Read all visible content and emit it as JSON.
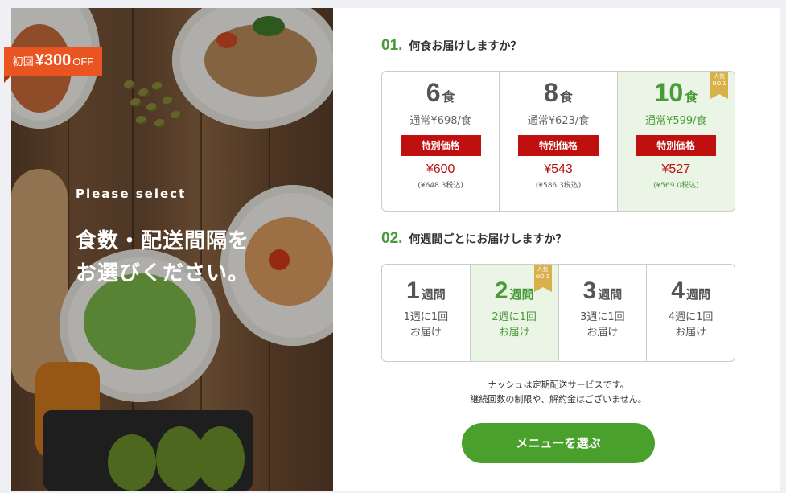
{
  "hero": {
    "subtitle": "Please select",
    "title_line1": "食数・配送間隔を",
    "title_line2": "お選びください。",
    "badge": {
      "prefix": "初回",
      "amount": "¥300",
      "suffix": "OFF"
    }
  },
  "q1": {
    "number": "01.",
    "text": "何食お届けしますか？",
    "options": [
      {
        "count": "6",
        "unit": "食",
        "regular": "通常¥698/食",
        "special": "特別価格",
        "price": "¥600",
        "tax": "(¥648.3税込)",
        "selected": false,
        "popular": false
      },
      {
        "count": "8",
        "unit": "食",
        "regular": "通常¥623/食",
        "special": "特別価格",
        "price": "¥543",
        "tax": "(¥586.3税込)",
        "selected": false,
        "popular": false
      },
      {
        "count": "10",
        "unit": "食",
        "regular": "通常¥599/食",
        "special": "特別価格",
        "price": "¥527",
        "tax": "(¥569.0税込)",
        "selected": true,
        "popular": true
      }
    ]
  },
  "popular_badge": {
    "line1": "人気",
    "line2": "NO.1"
  },
  "q2": {
    "number": "02.",
    "text": "何週間ごとにお届けしますか？",
    "options": [
      {
        "count": "1",
        "unit": "週間",
        "line1": "1週に1回",
        "line2": "お届け",
        "selected": false,
        "popular": false
      },
      {
        "count": "2",
        "unit": "週間",
        "line1": "2週に1回",
        "line2": "お届け",
        "selected": true,
        "popular": true
      },
      {
        "count": "3",
        "unit": "週間",
        "line1": "3週に1回",
        "line2": "お届け",
        "selected": false,
        "popular": false
      },
      {
        "count": "4",
        "unit": "週間",
        "line1": "4週に1回",
        "line2": "お届け",
        "selected": false,
        "popular": false
      }
    ]
  },
  "note": {
    "line1": "ナッシュは定期配送サービスです。",
    "line2": "継続回数の制限や、解約金はございません。"
  },
  "cta": {
    "label": "メニューを選ぶ"
  },
  "colors": {
    "accent": "#4aa02c",
    "price": "#b81010",
    "badge": "#e95420",
    "selected_bg": "#eaf5e5"
  }
}
